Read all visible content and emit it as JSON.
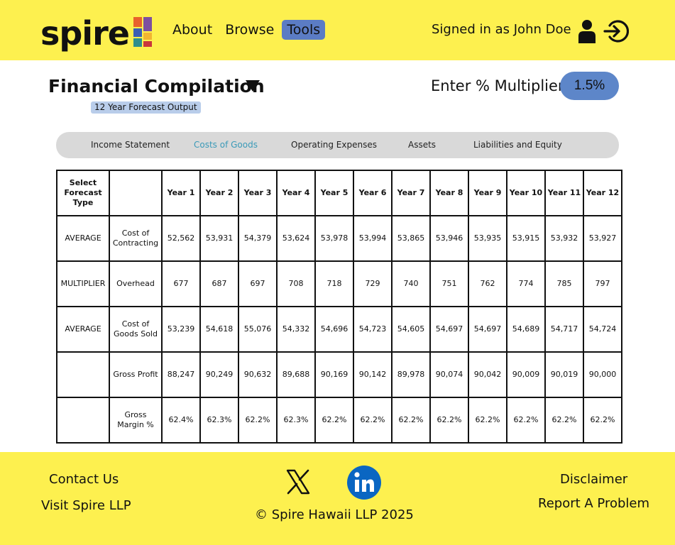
{
  "brand": {
    "logo_text": "spire",
    "mark_colors": [
      "#e8612c",
      "#f2b531",
      "#7d4fa0",
      "#3b5fb3",
      "#c9363b",
      "#2f8e8c"
    ]
  },
  "nav": {
    "items": [
      {
        "label": "About"
      },
      {
        "label": "Browse"
      },
      {
        "label": "Tools",
        "active": true
      }
    ]
  },
  "user": {
    "signed_in_text": "Signed in as John Doe",
    "user_icon": "user-icon",
    "logout_icon": "logout-icon"
  },
  "page": {
    "title": "Financial Compilation",
    "title_dropdown_icon": "triangle-down-icon",
    "subtitle": "12 Year Forecast Output",
    "multiplier_label": "Enter % Multiplier:",
    "multiplier_value": "1.5%"
  },
  "tabs": [
    {
      "label": "Income Statement",
      "active": false
    },
    {
      "label": "Costs of Goods",
      "active": true
    },
    {
      "label": "Operating Expenses",
      "active": false
    },
    {
      "label": "Assets",
      "active": false
    },
    {
      "label": "Liabilities and Equity",
      "active": false
    }
  ],
  "table": {
    "headers": [
      "Select Forecast Type",
      "",
      "Year 1",
      "Year 2",
      "Year 3",
      "Year 4",
      "Year 5",
      "Year 6",
      "Year 7",
      "Year 8",
      "Year 9",
      "Year 10",
      "Year 11",
      "Year 12"
    ],
    "rows": [
      {
        "type": "AVERAGE",
        "label": "Cost of Contracting",
        "values": [
          "52,562",
          "53,931",
          "54,379",
          "53,624",
          "53,978",
          "53,994",
          "53,865",
          "53,946",
          "53,935",
          "53,915",
          "53,932",
          "53,927"
        ]
      },
      {
        "type": "MULTIPLIER",
        "label": "Overhead",
        "values": [
          "677",
          "687",
          "697",
          "708",
          "718",
          "729",
          "740",
          "751",
          "762",
          "774",
          "785",
          "797"
        ]
      },
      {
        "type": "AVERAGE",
        "label": "Cost of Goods Sold",
        "values": [
          "53,239",
          "54,618",
          "55,076",
          "54,332",
          "54,696",
          "54,723",
          "54,605",
          "54,697",
          "54,697",
          "54,689",
          "54,717",
          "54,724"
        ]
      },
      {
        "type": "",
        "label": "Gross Profit",
        "values": [
          "88,247",
          "90,249",
          "90,632",
          "89,688",
          "90,169",
          "90,142",
          "89,978",
          "90,074",
          "90,042",
          "90,009",
          "90,019",
          "90,000"
        ]
      },
      {
        "type": "",
        "label": "Gross Margin %",
        "values": [
          "62.4%",
          "62.3%",
          "62.2%",
          "62.3%",
          "62.2%",
          "62.2%",
          "62.2%",
          "62.2%",
          "62.2%",
          "62.2%",
          "62.2%",
          "62.2%"
        ]
      }
    ]
  },
  "footer": {
    "contact": "Contact Us",
    "visit": "Visit Spire LLP",
    "disclaimer": "Disclaimer",
    "report": "Report A Problem",
    "copyright": "© Spire Hawaii LLP 2025",
    "social_icons": [
      "x-icon",
      "linkedin-icon"
    ]
  },
  "colors": {
    "header_bg": "#fdf04f",
    "active_nav": "#5b7cc4",
    "multiplier_bg": "#5d86c9",
    "badge_bg": "#b9cdea",
    "tab_bar_bg": "#d9d9d9",
    "active_tab_text": "#3a9ab8",
    "linkedin": "#0a66c2"
  }
}
